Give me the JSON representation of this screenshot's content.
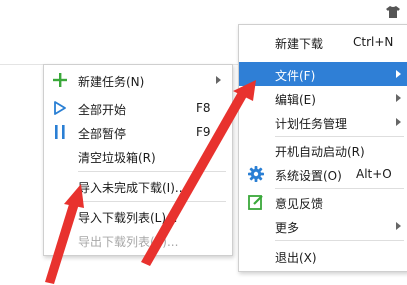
{
  "colors": {
    "highlight": "#2f7fd6",
    "annotation_arrow": "#e8322e",
    "icon_green": "#3aa83a",
    "icon_blue": "#2a7fd4"
  },
  "left_menu": {
    "items": [
      {
        "label": "新建任务(N)",
        "icon": "plus-icon",
        "submenu": true
      },
      {
        "label": "全部开始",
        "shortcut": "F8",
        "icon": "play-icon"
      },
      {
        "label": "全部暂停",
        "shortcut": "F9",
        "icon": "pause-icon"
      },
      {
        "label": "清空垃圾箱(R)"
      },
      {
        "label": "导入未完成下载(I)..."
      },
      {
        "label": "导入下载列表(L)..."
      },
      {
        "label": "导出下载列表(E)...",
        "disabled": true
      }
    ]
  },
  "right_menu": {
    "items": [
      {
        "label": "新建下载",
        "shortcut": "Ctrl+N"
      },
      {
        "label": "文件(F)",
        "submenu": true,
        "highlighted": true
      },
      {
        "label": "编辑(E)",
        "submenu": true
      },
      {
        "label": "计划任务管理",
        "submenu": true
      },
      {
        "label": "开机自动启动(R)"
      },
      {
        "label": "系统设置(O)",
        "shortcut": "Alt+O",
        "icon": "gear-icon"
      },
      {
        "label": "意见反馈",
        "icon": "feedback-icon"
      },
      {
        "label": "更多",
        "submenu": true
      },
      {
        "label": "退出(X)"
      }
    ]
  }
}
